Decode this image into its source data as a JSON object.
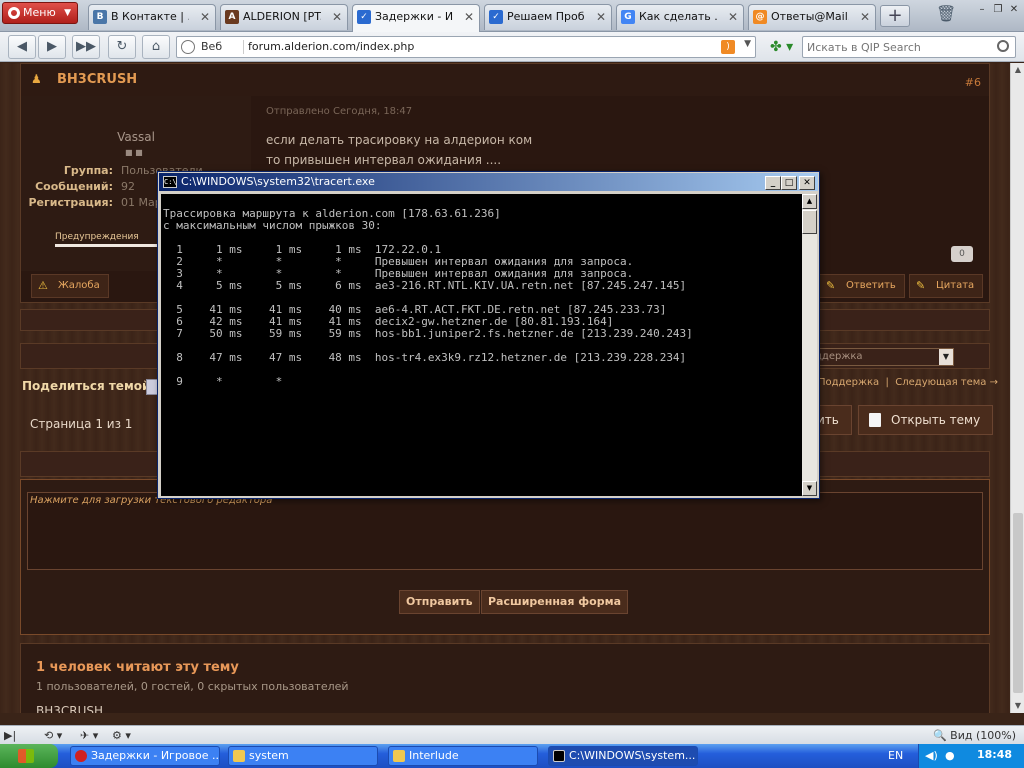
{
  "browser": {
    "menu_label": "Меню",
    "tabs": [
      {
        "label": "В Контакте | ...",
        "icon": "vk-icon",
        "color": "#4a76a8",
        "glyph": "B"
      },
      {
        "label": "ALDERION [PT...",
        "icon": "alderion-icon",
        "color": "#6a3a20",
        "glyph": "A"
      },
      {
        "label": "Задержки - И...",
        "icon": "forum-icon",
        "color": "#2a6ad0",
        "glyph": "✓"
      },
      {
        "label": "Решаем Проб...",
        "icon": "forum-icon",
        "color": "#2a6ad0",
        "glyph": "✓"
      },
      {
        "label": "Как сделать ...",
        "icon": "google-icon",
        "color": "#4285f4",
        "glyph": "G"
      },
      {
        "label": "Ответы@Mail...",
        "icon": "mail-icon",
        "color": "#f08a24",
        "glyph": "@"
      }
    ],
    "address": {
      "prefix": "Веб",
      "url": "forum.alderion.com/index.php"
    },
    "search_placeholder": "Искать в QIP Search",
    "status_zoom": "Вид (100%)"
  },
  "post": {
    "author": "BH3CRUSH",
    "number": "#6",
    "username": "Vassal",
    "fields": [
      {
        "label": "Группа:",
        "value": "Пользователи"
      },
      {
        "label": "Сообщений:",
        "value": "92"
      },
      {
        "label": "Регистрация:",
        "value": "01 Мар"
      }
    ],
    "warnings_label": "Предупреждения",
    "meta": "Отправлено Сегодня, 18:47",
    "body": [
      "если делать трасировку на алдерион ком",
      "то привышен интервал ожидания ...."
    ],
    "reputation": "0",
    "complaint": "Жалоба",
    "reply": "Ответить",
    "quote": "Цитата"
  },
  "page": {
    "share_label": "Поделиться темой:",
    "jump_select": "ддержка",
    "topic_links": {
      "section": "Поддержка",
      "next": "Следующая тема →"
    },
    "pages": "Страница 1 из 1",
    "reply_partial": "ить",
    "open_topic": "Открыть тему",
    "editor_hint": "Нажмите для загрузки текстового редактора",
    "send": "Отправить",
    "advanced": "Расширенная форма",
    "readers_title": "1 человек читают эту тему",
    "readers_sub": "1 пользователей, 0 гостей, 0 скрытых пользователей",
    "readers_who": "BH3CRUSH"
  },
  "cmd": {
    "title": "C:\\WINDOWS\\system32\\tracert.exe",
    "output": "Трассировка маршрута к alderion.com [178.63.61.236]\nс максимальным числом прыжков 30:\n\n  1     1 ms     1 ms     1 ms  172.22.0.1\n  2     *        *        *     Превышен интервал ожидания для запроса.\n  3     *        *        *     Превышен интервал ожидания для запроса.\n  4     5 ms     5 ms     6 ms  ae3-216.RT.NTL.KIV.UA.retn.net [87.245.247.145]\n\n  5    41 ms    41 ms    40 ms  ae6-4.RT.ACT.FKT.DE.retn.net [87.245.233.73]\n  6    42 ms    41 ms    41 ms  decix2-gw.hetzner.de [80.81.193.164]\n  7    50 ms    59 ms    59 ms  hos-bb1.juniper2.fs.hetzner.de [213.239.240.243]\n\n  8    47 ms    47 ms    48 ms  hos-tr4.ex3k9.rz12.hetzner.de [213.239.228.234]\n\n  9     *        *"
  },
  "taskbar": {
    "items": [
      {
        "label": "Задержки - Игровое ...",
        "icon": "opera-icon",
        "color": "#d02020"
      },
      {
        "label": "system",
        "icon": "folder-icon",
        "color": "#f0c850"
      },
      {
        "label": "Interlude",
        "icon": "folder-icon",
        "color": "#f0c850"
      },
      {
        "label": "C:\\WINDOWS\\system...",
        "icon": "cmd-icon",
        "color": "#000000"
      }
    ],
    "lang": "EN",
    "clock": "18:48"
  }
}
